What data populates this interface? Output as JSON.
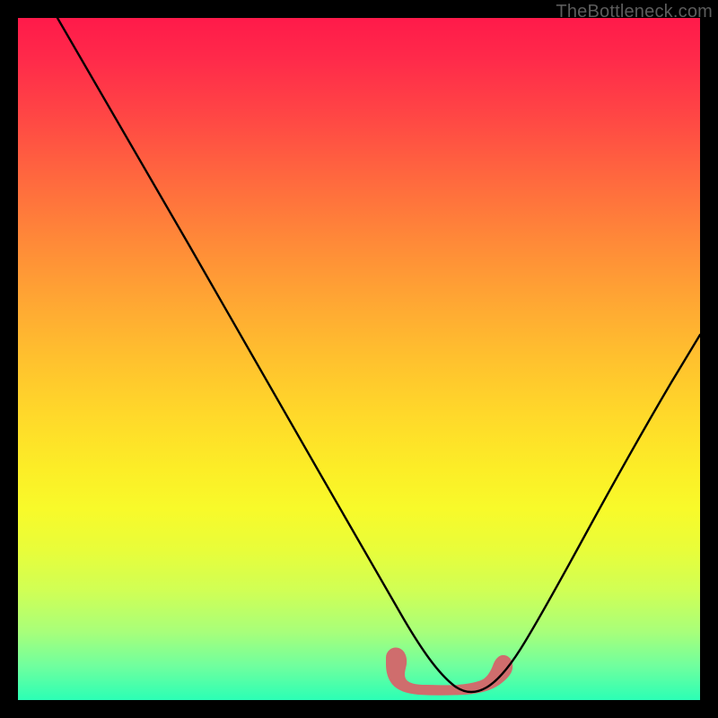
{
  "watermark": "TheBottleneck.com",
  "colors": {
    "frame": "#000000",
    "curve": "#000000",
    "blob": "#cf6d6d",
    "gradient_top": "#ff1a4a",
    "gradient_bottom": "#2bffb5"
  },
  "chart_data": {
    "type": "line",
    "title": "",
    "xlabel": "",
    "ylabel": "",
    "xlim": [
      0,
      100
    ],
    "ylim": [
      0,
      100
    ],
    "series": [
      {
        "name": "bottleneck-curve",
        "x": [
          6,
          10,
          15,
          20,
          25,
          30,
          35,
          40,
          45,
          50,
          53,
          56,
          59,
          62,
          65,
          68,
          71,
          74,
          77,
          80,
          83,
          86,
          89,
          92,
          95,
          98
        ],
        "y": [
          100,
          92,
          83,
          74,
          65,
          56,
          47,
          38,
          29,
          20,
          14,
          9,
          5,
          2.5,
          1.4,
          1.2,
          1.5,
          3,
          6,
          11,
          18,
          26,
          34,
          42,
          49,
          55
        ]
      }
    ],
    "annotations": [
      {
        "name": "optimal-zone-blob",
        "x_range": [
          54,
          70
        ],
        "y_range": [
          0.5,
          5
        ],
        "note": "highlighted pink region near curve minimum"
      }
    ]
  }
}
